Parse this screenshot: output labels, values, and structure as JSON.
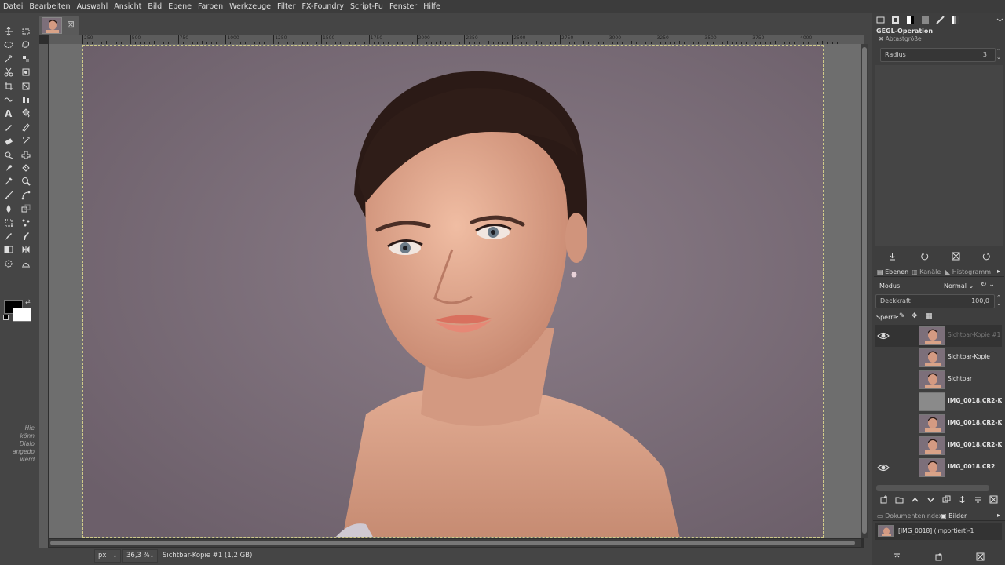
{
  "menu": [
    "Datei",
    "Bearbeiten",
    "Auswahl",
    "Ansicht",
    "Bild",
    "Ebene",
    "Farben",
    "Werkzeuge",
    "Filter",
    "FX-Foundry",
    "Script-Fu",
    "Fenster",
    "Hilfe"
  ],
  "toolbox": {
    "tools": [
      "move-tool",
      "rect-select-tool",
      "ellipse-select-tool",
      "free-select-tool",
      "fuzzy-select-tool",
      "select-by-color-tool",
      "scissors-tool",
      "foreground-select-tool",
      "crop-tool",
      "unified-transform-tool",
      "warp-transform-tool",
      "align-tool",
      "text-tool",
      "bucket-fill-tool",
      "paintbrush-tool",
      "pencil-tool",
      "eraser-tool",
      "airbrush-tool",
      "clone-tool",
      "heal-tool",
      "smudge-tool",
      "dodge-tool",
      "color-picker-tool",
      "zoom-tool",
      "measure-tool",
      "paths-tool",
      "blur-tool",
      "perspective-clone-tool",
      "cage-tool",
      "handle-transform-tool",
      "ink-tool",
      "myPaint-brush-tool",
      "gradient-tool",
      "flip-tool",
      "n-point-deformation-tool",
      "seamless-clone-tool"
    ],
    "fg_color": "#000000",
    "bg_color": "#ffffff",
    "hint_lines": [
      "Hie",
      "könn",
      "Dialo",
      "angedo",
      "werd"
    ]
  },
  "ruler_labels": [
    "250",
    "500",
    "750",
    "1000",
    "1250",
    "1500",
    "1750",
    "2000",
    "2250",
    "2500",
    "2750",
    "3000",
    "3250",
    "3500",
    "3750",
    "4000"
  ],
  "status": {
    "unit": "px",
    "zoom": "36,3 %",
    "layer_info": "Sichtbar-Kopie #1 (1,2 GB)"
  },
  "gegl": {
    "title": "GEGL-Operation",
    "subtitle": "Abtastgröße",
    "radius_label": "Radius",
    "radius_value": "3"
  },
  "layers_panel": {
    "tabs": [
      "Ebenen",
      "Kanäle",
      "Histogramm"
    ],
    "mode_label": "Modus",
    "mode_value": "Normal",
    "opacity_label": "Deckkraft",
    "opacity_value": "100,0",
    "lock_label": "Sperre:",
    "layers": [
      {
        "name": "Sichtbar-Kopie #1",
        "visible": true,
        "selected": true,
        "bold": false,
        "thumb": "photo"
      },
      {
        "name": "Sichtbar-Kopie",
        "visible": false,
        "selected": false,
        "bold": false,
        "thumb": "photo"
      },
      {
        "name": "Sichtbar",
        "visible": false,
        "selected": false,
        "bold": false,
        "thumb": "photo"
      },
      {
        "name": "IMG_0018.CR2-Kopie",
        "visible": false,
        "selected": false,
        "bold": true,
        "thumb": "gray"
      },
      {
        "name": "IMG_0018.CR2-Kopie",
        "visible": false,
        "selected": false,
        "bold": true,
        "thumb": "photo"
      },
      {
        "name": "IMG_0018.CR2-Kopie",
        "visible": false,
        "selected": false,
        "bold": true,
        "thumb": "photo"
      },
      {
        "name": "IMG_0018.CR2",
        "visible": true,
        "selected": false,
        "bold": true,
        "thumb": "photo"
      }
    ]
  },
  "images_panel": {
    "tabs": [
      "Dokumentenindex",
      "Bilder"
    ],
    "image_name": "[IMG_0018] (importiert)-1"
  },
  "colors": {
    "background": "#454545",
    "photo_bg": "#7c6f7a",
    "skin": "#d49a82",
    "hair": "#2b1a16"
  }
}
